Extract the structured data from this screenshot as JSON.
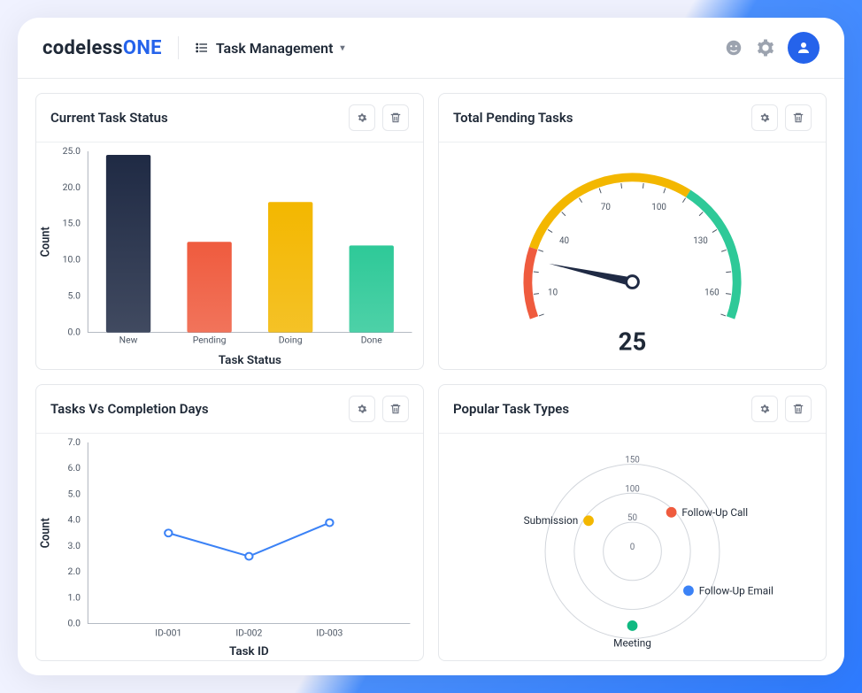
{
  "header": {
    "brand_a": "codeless",
    "brand_b": "ONE",
    "section": "Task Management"
  },
  "cards": {
    "c1": {
      "title": "Current Task Status"
    },
    "c2": {
      "title": "Total Pending Tasks"
    },
    "c3": {
      "title": "Tasks Vs Completion Days"
    },
    "c4": {
      "title": "Popular Task Types"
    }
  },
  "chart_data": [
    {
      "id": "current_task_status",
      "type": "bar",
      "title": "Current Task Status",
      "xlabel": "Task Status",
      "ylabel": "Count",
      "ylim": [
        0,
        25
      ],
      "yticks": [
        0,
        5,
        10,
        15,
        20,
        25
      ],
      "categories": [
        "New",
        "Pending",
        "Doing",
        "Done"
      ],
      "values": [
        24.5,
        12.5,
        18,
        12
      ],
      "colors": [
        "#1f2a44",
        "#ef5b3e",
        "#f3b700",
        "#2ec998"
      ]
    },
    {
      "id": "total_pending_tasks",
      "type": "gauge",
      "title": "Total Pending Tasks",
      "min": 0,
      "max": 170,
      "ticks": [
        10,
        40,
        70,
        100,
        130,
        160
      ],
      "value": 25,
      "arcs": [
        {
          "range": [
            0,
            30
          ],
          "color": "#ef5b3e"
        },
        {
          "range": [
            30,
            110
          ],
          "color": "#f3b700"
        },
        {
          "range": [
            110,
            170
          ],
          "color": "#2ec998"
        }
      ]
    },
    {
      "id": "tasks_vs_completion_days",
      "type": "line",
      "title": "Tasks Vs Completion Days",
      "xlabel": "Task ID",
      "ylabel": "Count",
      "ylim": [
        0,
        7
      ],
      "yticks": [
        0,
        1,
        2,
        3,
        4,
        5,
        6,
        7
      ],
      "categories": [
        "ID-001",
        "ID-002",
        "ID-003"
      ],
      "values": [
        3.5,
        2.6,
        3.9
      ],
      "color": "#3b82f6"
    },
    {
      "id": "popular_task_types",
      "type": "radar",
      "title": "Popular Task Types",
      "rlim": [
        0,
        150
      ],
      "rticks": [
        0,
        50,
        100,
        150
      ],
      "points": [
        {
          "label": "Follow-Up Call",
          "angle": 45,
          "r": 95,
          "color": "#ef5b3e"
        },
        {
          "label": "Follow-Up Email",
          "angle": 125,
          "r": 118,
          "color": "#3b82f6"
        },
        {
          "label": "Meeting",
          "angle": 180,
          "r": 128,
          "color": "#10b981"
        },
        {
          "label": "Submission",
          "angle": 305,
          "r": 92,
          "color": "#f3b700"
        }
      ]
    }
  ]
}
